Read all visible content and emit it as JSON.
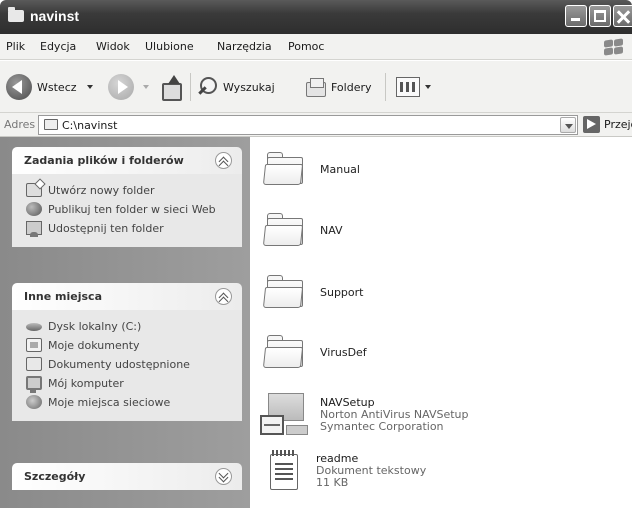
{
  "window": {
    "title": "navinst"
  },
  "menu": [
    "Plik",
    "Edycja",
    "Widok",
    "Ulubione",
    "Narzędzia",
    "Pomoc"
  ],
  "toolbar": {
    "back_label": "Wstecz",
    "search_label": "Wyszukaj",
    "folders_label": "Foldery"
  },
  "address": {
    "label": "Adres",
    "value": "C:\\navinst",
    "go_label": "Przejdź"
  },
  "panels": {
    "tasks": {
      "title": "Zadania plików i folderów",
      "items": [
        "Utwórz nowy folder",
        "Publikuj ten folder w sieci Web",
        "Udostępnij ten folder"
      ],
      "icons": [
        "new-folder-icon",
        "globe-icon",
        "share-folder-icon"
      ]
    },
    "places": {
      "title": "Inne miejsca",
      "items": [
        "Dysk lokalny (C:)",
        "Moje dokumenty",
        "Dokumenty udostępnione",
        "Mój komputer",
        "Moje miejsca sieciowe"
      ],
      "icons": [
        "local-disk-icon",
        "my-documents-icon",
        "shared-documents-icon",
        "my-computer-icon",
        "network-places-icon"
      ]
    },
    "details": {
      "title": "Szczegóły"
    }
  },
  "files": {
    "folders": [
      "Manual",
      "NAV",
      "Support",
      "VirusDef"
    ],
    "navsetup": {
      "name": "NAVSetup",
      "description": "Norton AntiVirus NAVSetup",
      "company": "Symantec Corporation"
    },
    "readme": {
      "name": "readme",
      "type": "Dokument tekstowy",
      "size": "11 KB"
    }
  }
}
